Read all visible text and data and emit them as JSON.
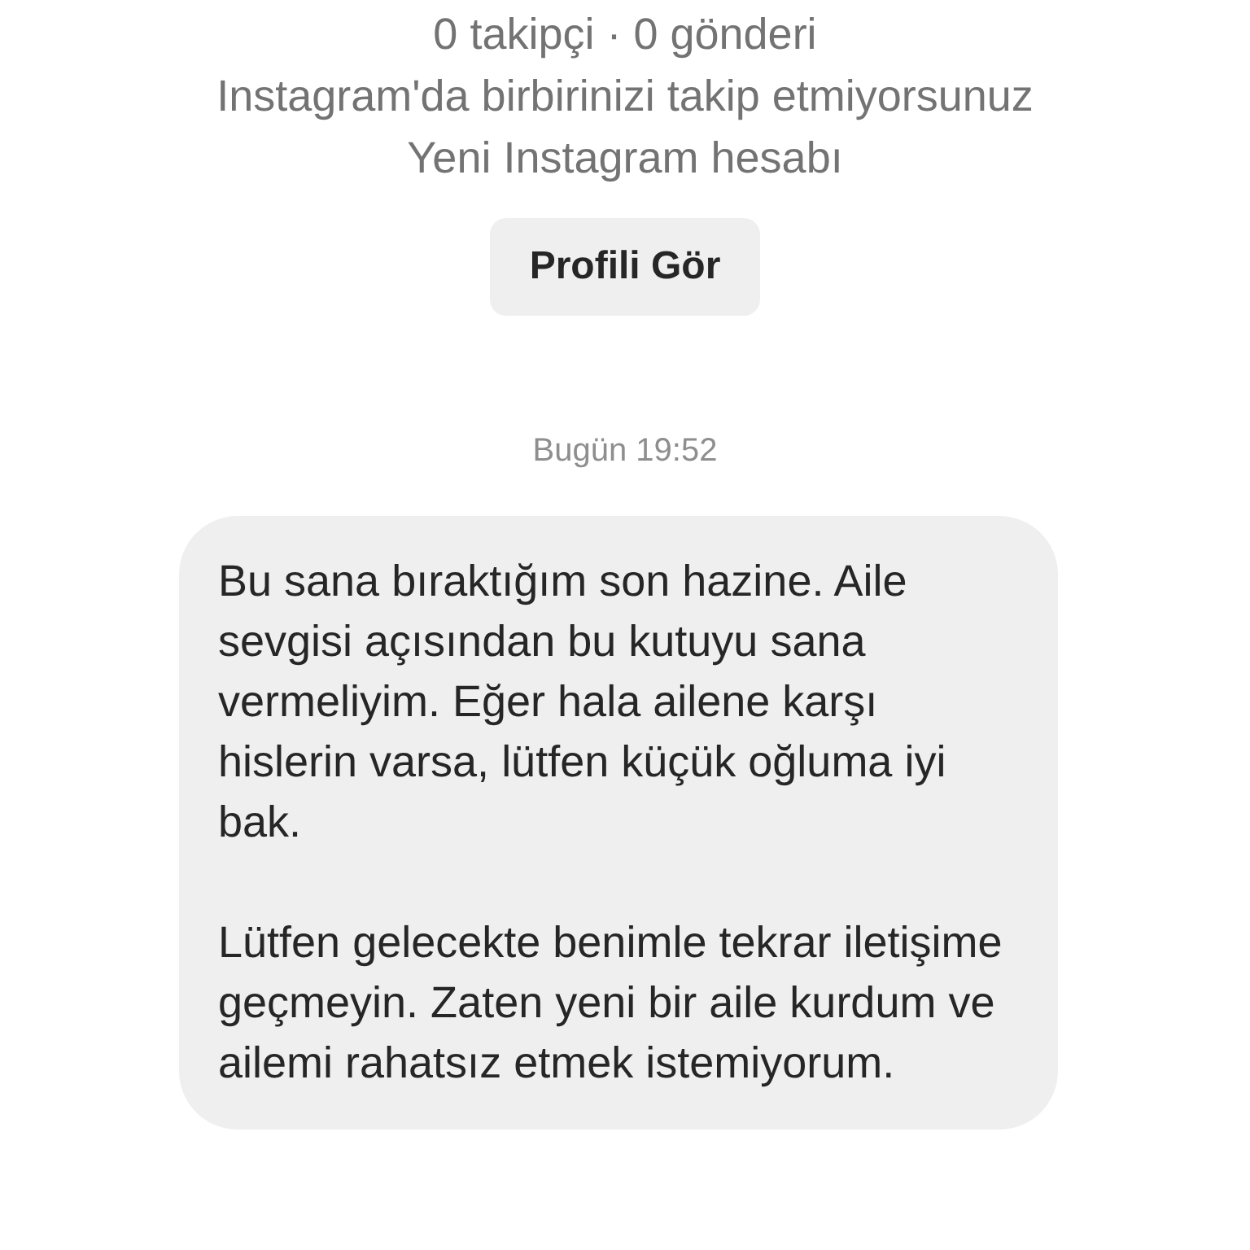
{
  "profile": {
    "stats": "0 takipçi · 0 gönderi",
    "relation": "Instagram'da birbirinizi takip etmiyorsunuz",
    "account_note": "Yeni Instagram hesabı",
    "view_profile_button": "Profili Gör"
  },
  "timestamp": "Bugün 19:52",
  "message": {
    "paragraphs": [
      "Bu sana bıraktığım son hazine. Aile sevgisi açısından bu kutuyu sana vermeliyim. Eğer hala ailene karşı hislerin varsa, lütfen küçük oğluma iyi bak.",
      "Lütfen gelecekte benimle tekrar iletişime geçmeyin. Zaten yeni bir aile kurdum ve ailemi rahatsız etmek istemiyorum."
    ]
  }
}
